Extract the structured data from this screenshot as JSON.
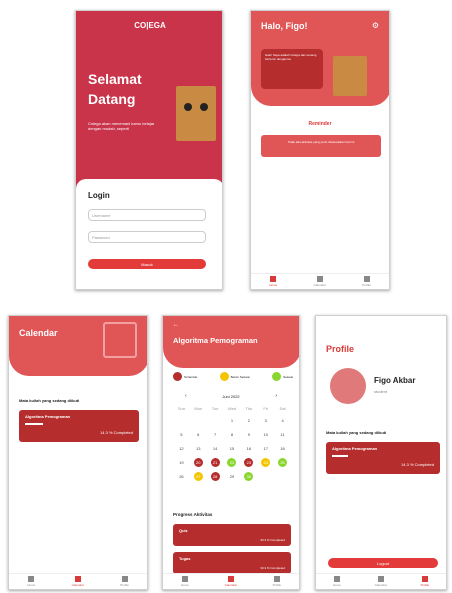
{
  "colors": {
    "primary": "#d93a3a",
    "dark": "#b52d2d",
    "yellow": "#f2c500",
    "green": "#8ad62f"
  },
  "welcome": {
    "logo": "CO|EGA",
    "title_line1": "Selamat",
    "title_line2": "Datang",
    "subtitle": "Colega akan menemani kamu belajar dengan mudah, seperti",
    "login_title": "Login",
    "username_placeholder": "Username",
    "password_placeholder": "Password",
    "login_button": "Masuk"
  },
  "home": {
    "greeting": "Halo, Figo!",
    "bubble_text": "Halo! Saya adalah Colega dan senang bertemu denganmu",
    "reminder_title": "Reminder",
    "reminder_text": "Tidak ada aktivitas yang perlu diselesaikan hari ini",
    "nav": [
      "Home",
      "Calendar",
      "Profile"
    ]
  },
  "calendar": {
    "title": "Calendar",
    "section_label": "Mata kuliah yang sedang diikuti",
    "course_name": "Algoritma Pemograman",
    "course_progress": "14.3 % Completed",
    "nav": [
      "Home",
      "Calendar",
      "Profile"
    ]
  },
  "detail": {
    "back": "←",
    "title": "Algoritma Pemograman",
    "legend": [
      {
        "label": "Terlambat",
        "color": "#b52d2d"
      },
      {
        "label": "Belum Selesai",
        "color": "#f2c500"
      },
      {
        "label": "Selesai",
        "color": "#8ad62f"
      }
    ],
    "month": "Juni 2022",
    "weekdays": [
      "Sun",
      "Mon",
      "Tue",
      "Wed",
      "Thu",
      "Fri",
      "Sat"
    ],
    "days": [
      "",
      "",
      "",
      "1",
      "2",
      "3",
      "4",
      "5",
      "6",
      "7",
      "8",
      "9",
      "10",
      "11",
      "12",
      "13",
      "14",
      "15",
      "16",
      "17",
      "18",
      "19",
      "20",
      "21",
      "22",
      "23",
      "24",
      "25",
      "26",
      "27",
      "28",
      "29",
      "30",
      "",
      ""
    ],
    "progress_title": "Progress Aktivitas",
    "activities": [
      {
        "name": "Quiz",
        "status": "33.3 % Completed"
      },
      {
        "name": "Tugas",
        "status": "33.3 % Completed"
      }
    ],
    "nav": [
      "Home",
      "Calendar",
      "Profile"
    ]
  },
  "profile": {
    "title": "Profile",
    "name": "Figo Akbar",
    "role": "student",
    "section_label": "Mata kuliah yang sedang diikuti",
    "course_name": "Algoritma Pemograman",
    "course_progress": "14.3 % Completed",
    "logout": "Logout",
    "nav": [
      "Home",
      "Calendar",
      "Profile"
    ]
  }
}
